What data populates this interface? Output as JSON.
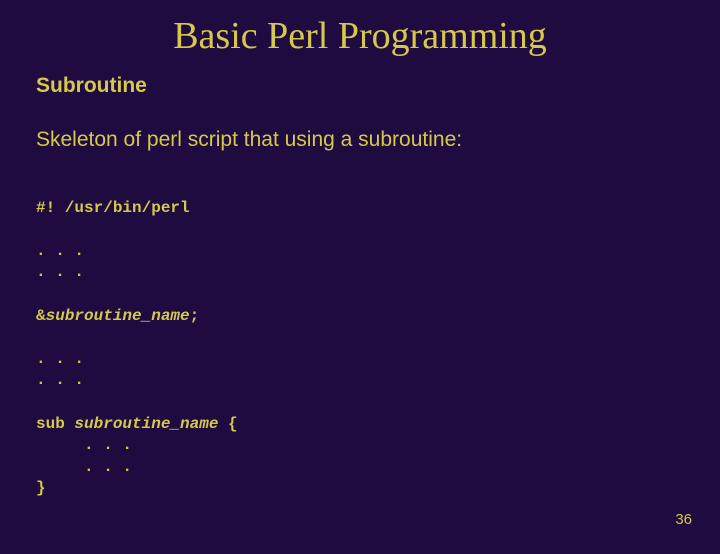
{
  "title": "Basic Perl Programming",
  "subheading": "Subroutine",
  "skeleton_line": "Skeleton of perl script that using a subroutine:",
  "code": {
    "shebang": "#! /usr/bin/perl",
    "dots1a": ". . .",
    "dots1b": ". . .",
    "call_amp": "&",
    "call_name": "subroutine_name",
    "call_semi": ";",
    "dots2a": ". . .",
    "dots2b": ". . .",
    "sub_kw": "sub ",
    "sub_name": "subroutine_name",
    "sub_open": " {",
    "body1": "     . . .",
    "body2": "     . . .",
    "close": "}"
  },
  "page_number": "36"
}
